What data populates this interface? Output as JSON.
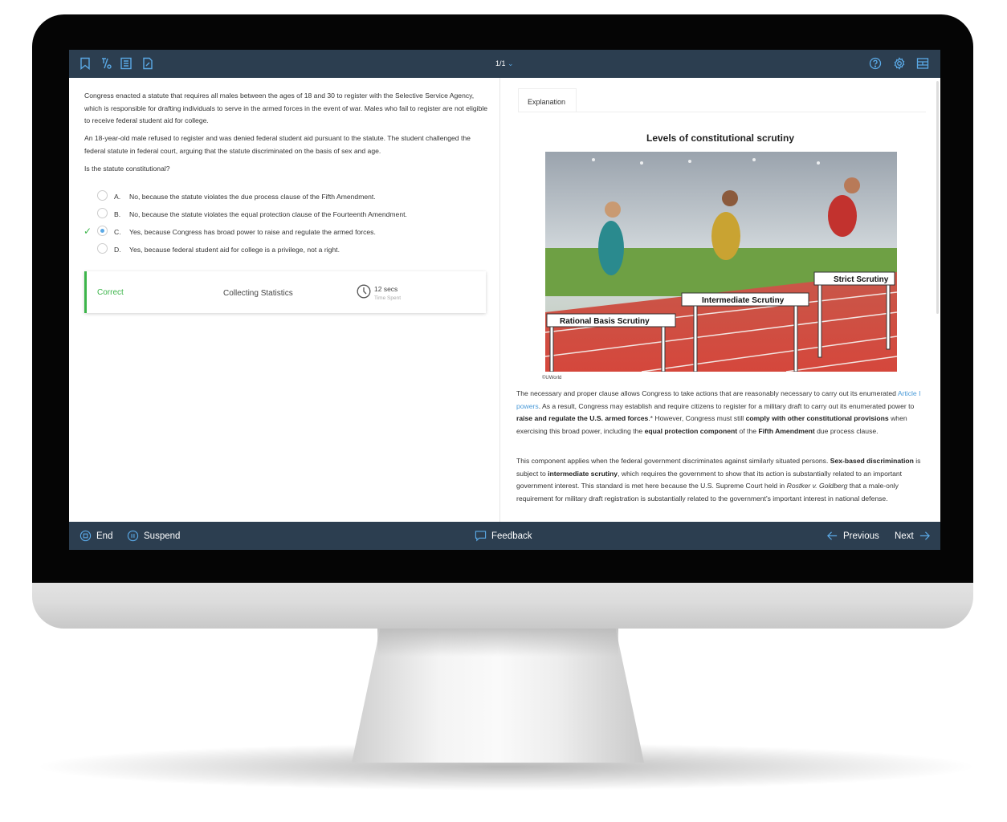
{
  "topbar": {
    "icons": [
      "bookmark-icon",
      "percent-icon",
      "notes-icon",
      "edit-icon",
      "help-icon",
      "gear-icon",
      "layout-icon"
    ],
    "pager": "1/1",
    "accent": "#5aa9e6",
    "bg": "#2c3e50"
  },
  "question": {
    "paragraphs": [
      "Congress enacted a statute that requires all males between the ages of 18 and 30 to register with the Selective Service Agency, which is responsible for drafting individuals to serve in the armed forces in the event of war.  Males who fail to register are not eligible to receive federal student aid for college.",
      "An 18-year-old male refused to register and was denied federal student aid pursuant to the statute.  The student challenged the federal statute in federal court, arguing that the statute discriminated on the basis of sex and age.",
      "Is the statute constitutional?"
    ],
    "options": [
      {
        "letter": "A.",
        "text": "No, because the statute violates the due process clause of the Fifth Amendment."
      },
      {
        "letter": "B.",
        "text": "No, because the statute violates the equal protection clause of the Fourteenth Amendment."
      },
      {
        "letter": "C.",
        "text": "Yes, because Congress has broad power to raise and regulate the armed forces."
      },
      {
        "letter": "D.",
        "text": "Yes, because federal student aid for college is a privilege, not a right."
      }
    ],
    "selected": "C.",
    "correct": "C."
  },
  "result": {
    "status": "Correct",
    "stats": "Collecting Statistics",
    "time": "12 secs",
    "time_label": "Time Spent",
    "color": "#3cb54a"
  },
  "explanation": {
    "tab": "Explanation",
    "figure_title": "Levels of constitutional scrutiny",
    "figure_labels": [
      "Strict Scrutiny",
      "Intermediate Scrutiny",
      "Rational Basis Scrutiny"
    ],
    "credit": "©UWorld",
    "paragraphs": [
      [
        {
          "t": "The necessary and proper clause allows Congress to take actions that are reasonably necessary to carry out its enumerated "
        },
        {
          "t": "Article I powers",
          "s": "link"
        },
        {
          "t": ".  As a result, Congress may establish and require citizens to register for a military draft to carry out its enumerated power to "
        },
        {
          "t": "raise and regulate the U.S. armed forces",
          "s": "bold"
        },
        {
          "t": ".*  However, Congress must still "
        },
        {
          "t": "comply with other constitutional provisions",
          "s": "bold"
        },
        {
          "t": " when exercising this broad power, including the "
        },
        {
          "t": "equal protection component",
          "s": "bold"
        },
        {
          "t": " of the "
        },
        {
          "t": "Fifth Amendment",
          "s": "bold"
        },
        {
          "t": " due process clause."
        }
      ],
      [
        {
          "t": "This component applies when the federal government discriminates against similarly situated persons.  "
        },
        {
          "t": "Sex-based discrimination",
          "s": "bold"
        },
        {
          "t": " is subject to "
        },
        {
          "t": "intermediate scrutiny",
          "s": "bold"
        },
        {
          "t": ", which requires the government to show that its action is substantially related to an important government interest.  This standard is met here because the U.S. Supreme Court held in "
        },
        {
          "t": "Rostker v. Goldberg",
          "s": "italic"
        },
        {
          "t": " that a male-only requirement for military draft registration is substantially related to the government's important interest in national defense."
        }
      ]
    ]
  },
  "bottombar": {
    "end": "End",
    "suspend": "Suspend",
    "feedback": "Feedback",
    "previous": "Previous",
    "next": "Next"
  }
}
